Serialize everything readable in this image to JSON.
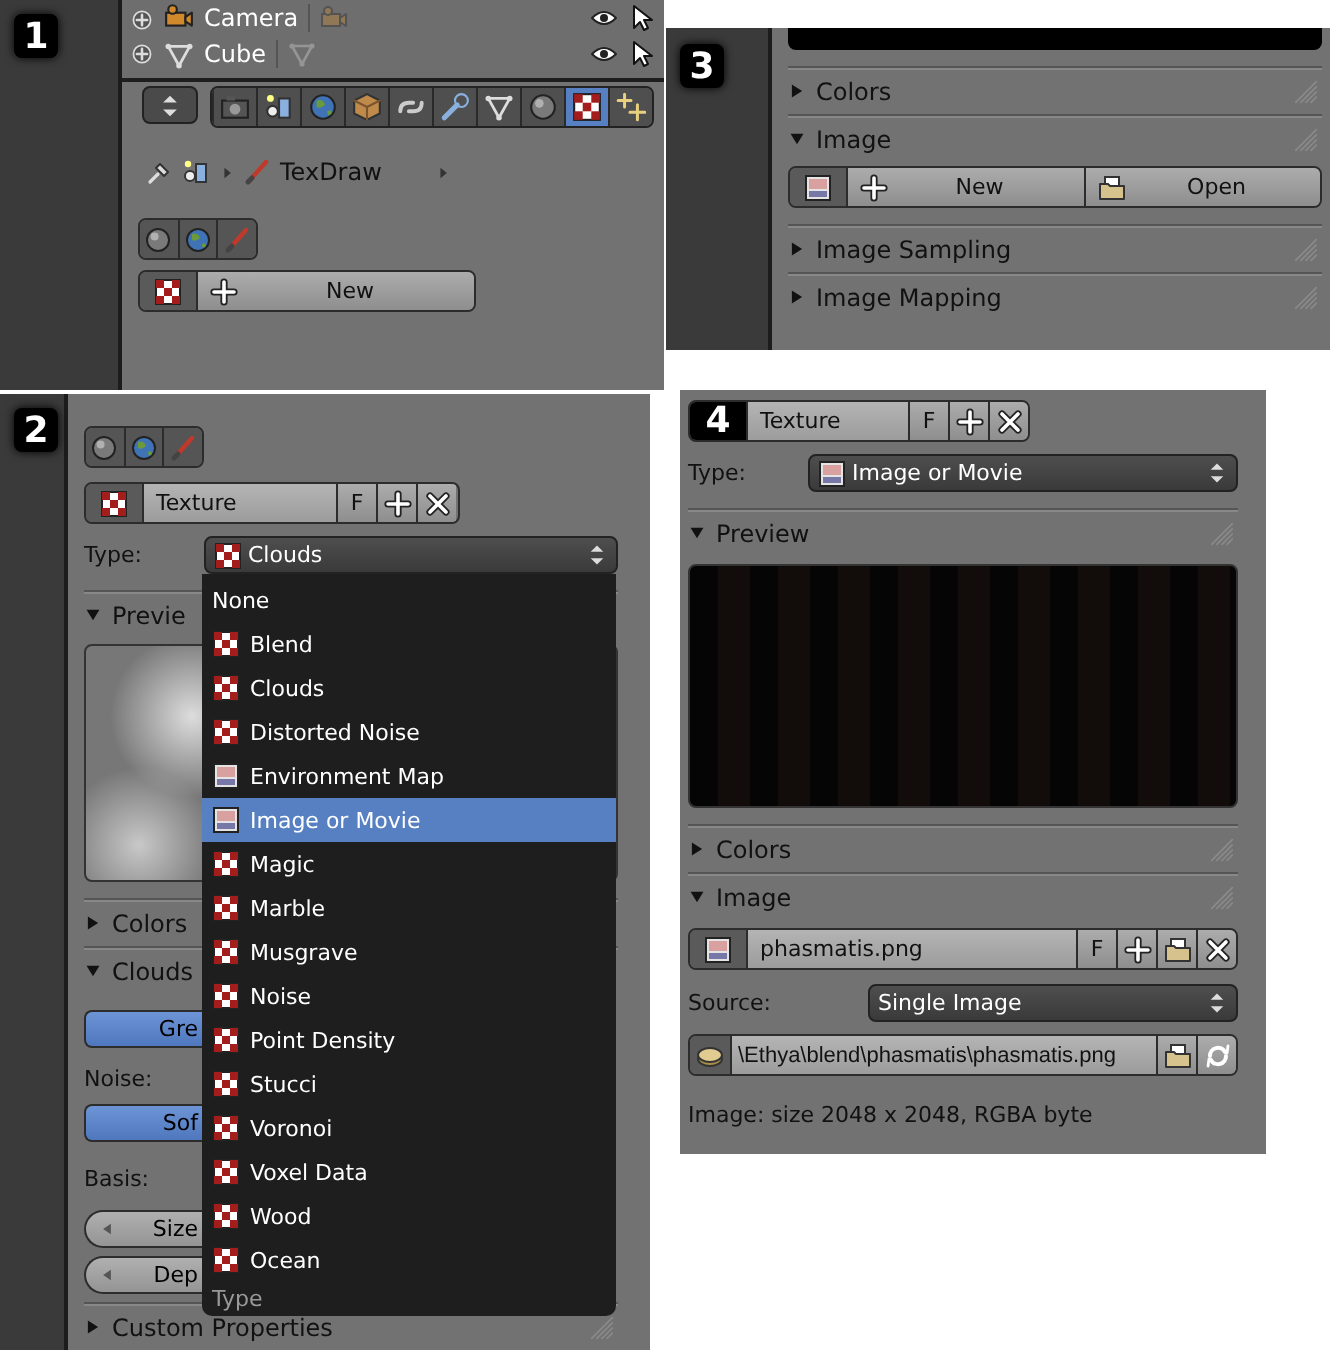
{
  "panel_1": {
    "number": "1",
    "outliner": [
      {
        "kind": "camera",
        "name": "Camera"
      },
      {
        "kind": "mesh",
        "name": "Cube"
      }
    ],
    "tabs": [
      {
        "kind": "render",
        "selected": false
      },
      {
        "kind": "scene",
        "selected": false
      },
      {
        "kind": "world",
        "selected": false
      },
      {
        "kind": "object",
        "selected": false
      },
      {
        "kind": "constraints",
        "selected": false
      },
      {
        "kind": "modifiers",
        "selected": false
      },
      {
        "kind": "data",
        "selected": false
      },
      {
        "kind": "material",
        "selected": false
      },
      {
        "kind": "texture",
        "selected": true
      },
      {
        "kind": "particles",
        "selected": false
      }
    ],
    "context": "TexDraw",
    "slots": [
      {
        "kind": "material"
      },
      {
        "kind": "world"
      },
      {
        "kind": "brush"
      }
    ],
    "new_button": "New"
  },
  "panel_3": {
    "number": "3",
    "sections": [
      {
        "title": "Colors",
        "expanded": false
      },
      {
        "title": "Image",
        "expanded": true,
        "buttons": [
          {
            "kind": "new",
            "label": "New"
          },
          {
            "kind": "open",
            "label": "Open"
          }
        ]
      },
      {
        "title": "Image Sampling",
        "expanded": false
      },
      {
        "title": "Image Mapping",
        "expanded": false
      }
    ]
  },
  "panel_2": {
    "number": "2",
    "slots": [
      {
        "kind": "material"
      },
      {
        "kind": "world"
      },
      {
        "kind": "brush"
      }
    ],
    "texture": {
      "name": "Texture",
      "fake_user": "F"
    },
    "type_label": "Type:",
    "type_value": "Clouds",
    "sections": [
      {
        "kind": "preview",
        "title": "Previe",
        "expanded": true
      },
      {
        "title": "Colors",
        "expanded": false
      },
      {
        "kind": "clouds",
        "title": "Clouds",
        "expanded": true
      },
      {
        "title": "Custom Properties",
        "expanded": false
      }
    ],
    "clouds": {
      "color_toggle": [
        {
          "label": "Gre",
          "selected": true
        }
      ],
      "noise_label": "Noise:",
      "noise_toggle": [
        {
          "label": "Sof",
          "selected": true
        }
      ],
      "basis_label": "Basis:",
      "size_slider": "Size",
      "depth_slider": "Dep"
    },
    "type_menu": {
      "items": [
        {
          "kind": "none",
          "label": "None",
          "selected": false
        },
        {
          "kind": "checker",
          "label": "Blend",
          "selected": false
        },
        {
          "kind": "checker",
          "label": "Clouds",
          "selected": false
        },
        {
          "kind": "checker",
          "label": "Distorted Noise",
          "selected": false
        },
        {
          "kind": "image",
          "label": "Environment Map",
          "selected": false
        },
        {
          "kind": "image",
          "label": "Image or Movie",
          "selected": true
        },
        {
          "kind": "checker",
          "label": "Magic",
          "selected": false
        },
        {
          "kind": "checker",
          "label": "Marble",
          "selected": false
        },
        {
          "kind": "checker",
          "label": "Musgrave",
          "selected": false
        },
        {
          "kind": "checker",
          "label": "Noise",
          "selected": false
        },
        {
          "kind": "checker",
          "label": "Point Density",
          "selected": false
        },
        {
          "kind": "checker",
          "label": "Stucci",
          "selected": false
        },
        {
          "kind": "checker",
          "label": "Voronoi",
          "selected": false
        },
        {
          "kind": "checker",
          "label": "Voxel Data",
          "selected": false
        },
        {
          "kind": "checker",
          "label": "Wood",
          "selected": false
        },
        {
          "kind": "checker",
          "label": "Ocean",
          "selected": false
        }
      ],
      "title": "Type"
    }
  },
  "panel_4": {
    "number": "4",
    "texture": {
      "name": "Texture",
      "fake_user": "F"
    },
    "type_label": "Type:",
    "type_value": "Image or Movie",
    "sections": [
      {
        "kind": "preview",
        "title": "Preview",
        "expanded": true
      },
      {
        "title": "Colors",
        "expanded": false
      },
      {
        "kind": "image",
        "title": "Image",
        "expanded": true
      }
    ],
    "image": {
      "name": "phasmatis.png",
      "fake_user": "F"
    },
    "source_label": "Source:",
    "source_value": "Single Image",
    "path": "\\Ethya\\blend\\phasmatis\\phasmatis.png",
    "info": "Image: size 2048 x 2048, RGBA byte"
  }
}
